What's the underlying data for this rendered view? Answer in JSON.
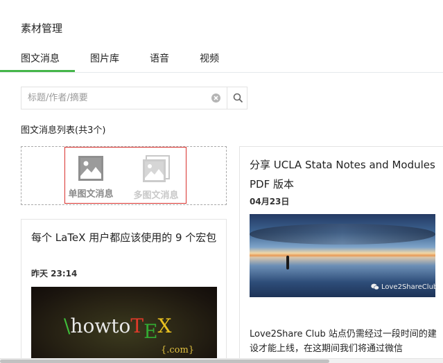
{
  "header": {
    "title": "素材管理"
  },
  "tabs": [
    {
      "label": "图文消息",
      "active": true
    },
    {
      "label": "图片库",
      "active": false
    },
    {
      "label": "语音",
      "active": false
    },
    {
      "label": "视频",
      "active": false
    }
  ],
  "search": {
    "placeholder": "标题/作者/摘要",
    "value": ""
  },
  "list": {
    "title": "图文消息列表(共3个)"
  },
  "create": {
    "single_label": "单图文消息",
    "multi_label": "多图文消息"
  },
  "cards": [
    {
      "title": "每个 LaTeX 用户都应该使用的 9 个宏包",
      "date": "昨天 23:14",
      "thumb": {
        "logo_prefix": "\\",
        "logo_word": "howto",
        "logo_t": "T",
        "logo_e": "E",
        "logo_x": "X",
        "logo_sub": "{.com}"
      }
    },
    {
      "title": "分享 UCLA Stata Notes and Modules PDF 版本",
      "date": "04月23日",
      "thumb": {
        "watermark": "Love2ShareClub"
      },
      "description": "Love2Share Club 站点仍需经过一段时间的建设才能上线，在这期间我们将通过微信"
    }
  ],
  "colors": {
    "accent": "#44b549",
    "highlight": "#d9302c"
  }
}
